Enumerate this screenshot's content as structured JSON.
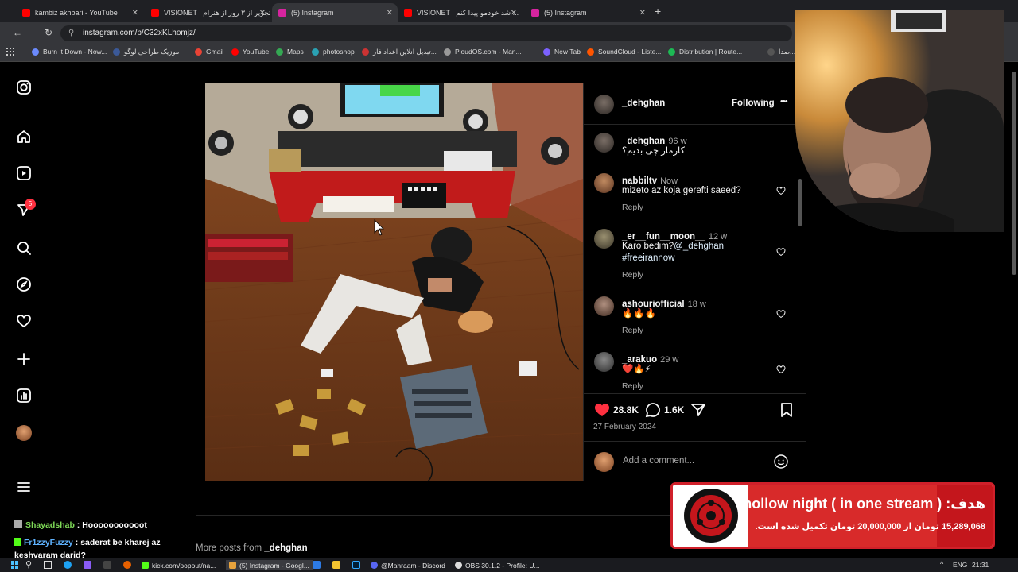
{
  "browser": {
    "tabs": [
      {
        "label": "kambiz akhbari - YouTube",
        "color": "#ff0000",
        "active": false
      },
      {
        "label": "VISIONET | تجزیر از ۳ روز از هنرام",
        "color": "#ff0000",
        "active": false
      },
      {
        "label": "(5) Instagram",
        "color": "#d6249f",
        "active": true
      },
      {
        "label": "VISIONET | شد خودمو پیدا کنم ...",
        "color": "#ff0000",
        "active": false
      },
      {
        "label": "(5) Instagram",
        "color": "#d6249f",
        "active": false
      }
    ],
    "new_tab": "+",
    "url": "instagram.com/p/C32xKLhomjz/",
    "bookmarks": [
      {
        "label": "Burn It Down - Now...",
        "color": "#6b8afd"
      },
      {
        "label": "موزیک طراحی لوگو",
        "color": "#3b5998"
      },
      {
        "label": "Gmail",
        "color": "#ea4335"
      },
      {
        "label": "YouTube",
        "color": "#ff0000"
      },
      {
        "label": "Maps",
        "color": "#34a853"
      },
      {
        "label": "photoshop",
        "color": "#2aa1b3"
      },
      {
        "label": "تبدیل آنلاین اعداد فار...",
        "color": "#c33"
      },
      {
        "label": "PloudOS.com - Man...",
        "color": "#999"
      },
      {
        "label": "New Tab",
        "color": "#7b61ff"
      },
      {
        "label": "SoundCloud - Liste...",
        "color": "#ff5500"
      },
      {
        "label": "Distribution | Route...",
        "color": "#1db954"
      },
      {
        "label": "صدا...",
        "color": "#555"
      }
    ]
  },
  "post": {
    "author": "_dehghan",
    "follow_label": "Following",
    "more": "•••",
    "comments": [
      {
        "user": "_dehghan",
        "time": "96 w",
        "text": "کارمار چی بدیم؟",
        "reply": "",
        "like": false
      },
      {
        "user": "nabbiltv",
        "time": "Now",
        "text": "mizeto az koja gerefti saeed?",
        "reply": "Reply",
        "like": true
      },
      {
        "user": "_er__fun__moon__",
        "time": "12 w",
        "text": "Karo bedim?",
        "mention": "@_dehghan",
        "hashtag": "#freeirannow",
        "reply": "Reply",
        "like": true
      },
      {
        "user": "ashouriofficial",
        "time": "18 w",
        "text": "🔥🔥🔥",
        "reply": "Reply",
        "like": true
      },
      {
        "user": "_arakuo",
        "time": "29 w",
        "text": "❤️🔥⚡",
        "reply": "Reply",
        "like": true
      }
    ],
    "likes": "28.8K",
    "comment_count": "1.6K",
    "date": "27 February 2024",
    "add_comment_placeholder": "Add a comment...",
    "more_posts_prefix": "More posts from",
    "more_posts_user": "_dehghan"
  },
  "donation": {
    "title": "هدف: ( hollow night ( in one stream",
    "subtitle": "15,289,068 تومان از 20,000,000 تومان تکمیل شده است.",
    "progress": 0.764
  },
  "chat": [
    {
      "user": "Shayadshab",
      "sep": " : ",
      "text": "Hooooooooooot",
      "color": "#7ed957"
    },
    {
      "user": "Fr1zzyFuzzy",
      "sep": " : ",
      "text": "saderat be kharej az keshvaram darid?",
      "color": "#5fb3ff"
    }
  ],
  "taskbar": {
    "items": [
      {
        "label": "kick.com/popout/na...",
        "color": "#53fc18"
      },
      {
        "label": "(5) Instagram - Googl...",
        "color": "#e8a33d"
      },
      {
        "label": "@Mahraam - Discord",
        "color": "#5865f2"
      },
      {
        "label": "OBS 30.1.2 - Profile: U...",
        "color": "#ddd"
      }
    ],
    "lang": "ENG",
    "clock": "21:31"
  },
  "notification_badge": "5",
  "colors": {
    "like_red": "#ff3040",
    "link_blue": "#e0f1ff",
    "bg": "#000000"
  }
}
